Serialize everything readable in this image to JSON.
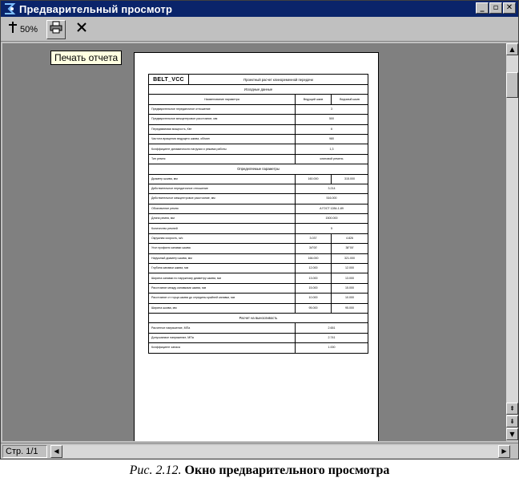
{
  "window": {
    "title": "Предварительный просмотр",
    "min_label": "_",
    "max_label": "▫",
    "close_label": "✕"
  },
  "toolbar": {
    "zoom_label": "50%",
    "print_tooltip": "Печать отчета"
  },
  "statusbar": {
    "page_label": "Стр. 1/1"
  },
  "document": {
    "code": "BELT_VCC",
    "title": "Проектный расчет клиноременной передачи",
    "section_input": "Исходные данные",
    "header": {
      "param": "Наименование параметра",
      "driving": "Ведущий шкив",
      "driven": "Ведомый шкив"
    },
    "input_rows": [
      {
        "label": "Предварительное передаточное отношение",
        "value": "3"
      },
      {
        "label": "Предварительное межцентровое расстояние, мм",
        "value": "500"
      },
      {
        "label": "Передаваемая мощность, Квт",
        "value": "6"
      },
      {
        "label": "Частота вращения ведущего шкива, об/мин",
        "value": "980"
      },
      {
        "label": "Коэффициент динамичности нагрузки и режима работы",
        "value": "1,3"
      },
      {
        "label": "Тип ремня",
        "value": "клиновой ремень"
      }
    ],
    "section_results": "Определяемые параметры",
    "result_rows": [
      {
        "label": "Диаметр шкива, мм",
        "v1": "160.000",
        "v2": "315.000"
      },
      {
        "label": "Действительное передаточное отношение",
        "value": "3.214"
      },
      {
        "label": "Действительное межцентровое расстояние, мм",
        "value": "516.000"
      },
      {
        "label": "Обозначение ремня",
        "value": "A ГОСТ 1284-1-89"
      },
      {
        "label": "Длина ремня, мм",
        "value": "1500.000"
      },
      {
        "label": "Количество ремней",
        "value": "5"
      },
      {
        "label": "Окружная скорость, м/с",
        "v1": "3.037",
        "v2": "4.826"
      },
      {
        "label": "Угол профиля канавки шкива",
        "v1": "34°00'",
        "v2": "38°00'"
      },
      {
        "label": "Наружный диаметр шкива, мм",
        "v1": "166.000",
        "v2": "321.000"
      },
      {
        "label": "Глубина канавки шкива, мм",
        "v1": "12.000",
        "v2": "12.000"
      },
      {
        "label": "Ширина канавки по наружному диаметру шкива, мм",
        "v1": "13.000",
        "v2": "13.000"
      },
      {
        "label": "Расстояние между канавками шкива, мм",
        "v1": "15.000",
        "v2": "15.000"
      },
      {
        "label": "Расстояние от торца шкива до середины крайней канавки, мм",
        "v1": "10.000",
        "v2": "10.000"
      },
      {
        "label": "Ширина шкива, мм",
        "v1": "95.000",
        "v2": "95.000"
      }
    ],
    "section_strength": "Расчет на выносливость",
    "strength_rows": [
      {
        "label": "Расчетное напряжение, МПа",
        "value": "2.651"
      },
      {
        "label": "Допускаемое напряжение, МПа",
        "value": "2.741"
      },
      {
        "label": "Коэффициент запаса",
        "value": "1.000"
      }
    ]
  },
  "caption": {
    "fig": "Рис. 2.12.",
    "text": "Окно предварительного просмотра"
  }
}
